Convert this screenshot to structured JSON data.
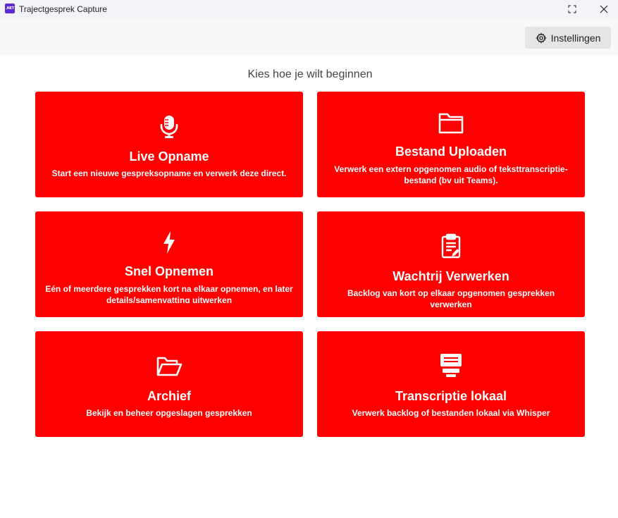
{
  "window": {
    "title": "Trajectgesprek Capture",
    "app_badge": ".NET",
    "controls": [
      "minimize-icon",
      "maximize-icon",
      "close-icon"
    ]
  },
  "toolbar": {
    "settings_label": "Instellingen",
    "settings_icon": "gear-icon"
  },
  "main": {
    "heading": "Kies hoe je wilt beginnen",
    "cards": [
      {
        "title": "Live Opname",
        "description": "Start een nieuwe gespreksopname en verwerk deze direct.",
        "icon": "microphone-icon"
      },
      {
        "title": "Bestand Uploaden",
        "description": "Verwerk een extern opgenomen audio of teksttranscriptie-bestand (bv uit Teams).",
        "icon": "folder-icon"
      },
      {
        "title": "Snel Opnemen",
        "description": "Eén of meerdere gesprekken kort na elkaar opnemen, en later details/samenvatting uitwerken",
        "icon": "lightning-icon"
      },
      {
        "title": "Wachtrij Verwerken",
        "description": "Backlog van kort op elkaar opgenomen gesprekken verwerken",
        "icon": "clipboard-icon"
      },
      {
        "title": "Archief",
        "description": "Bekijk en beheer opgeslagen gesprekken",
        "icon": "open-folder-icon"
      },
      {
        "title": "Transcriptie lokaal",
        "description": "Verwerk backlog of bestanden lokaal via Whisper",
        "icon": "server-icon"
      }
    ]
  },
  "colors": {
    "card_background": "#ff0000",
    "card_text": "#ffffff",
    "titlebar_background": "#f2f4f8",
    "toolbar_background": "#f8f8f8",
    "button_background": "#e5e5e5"
  }
}
